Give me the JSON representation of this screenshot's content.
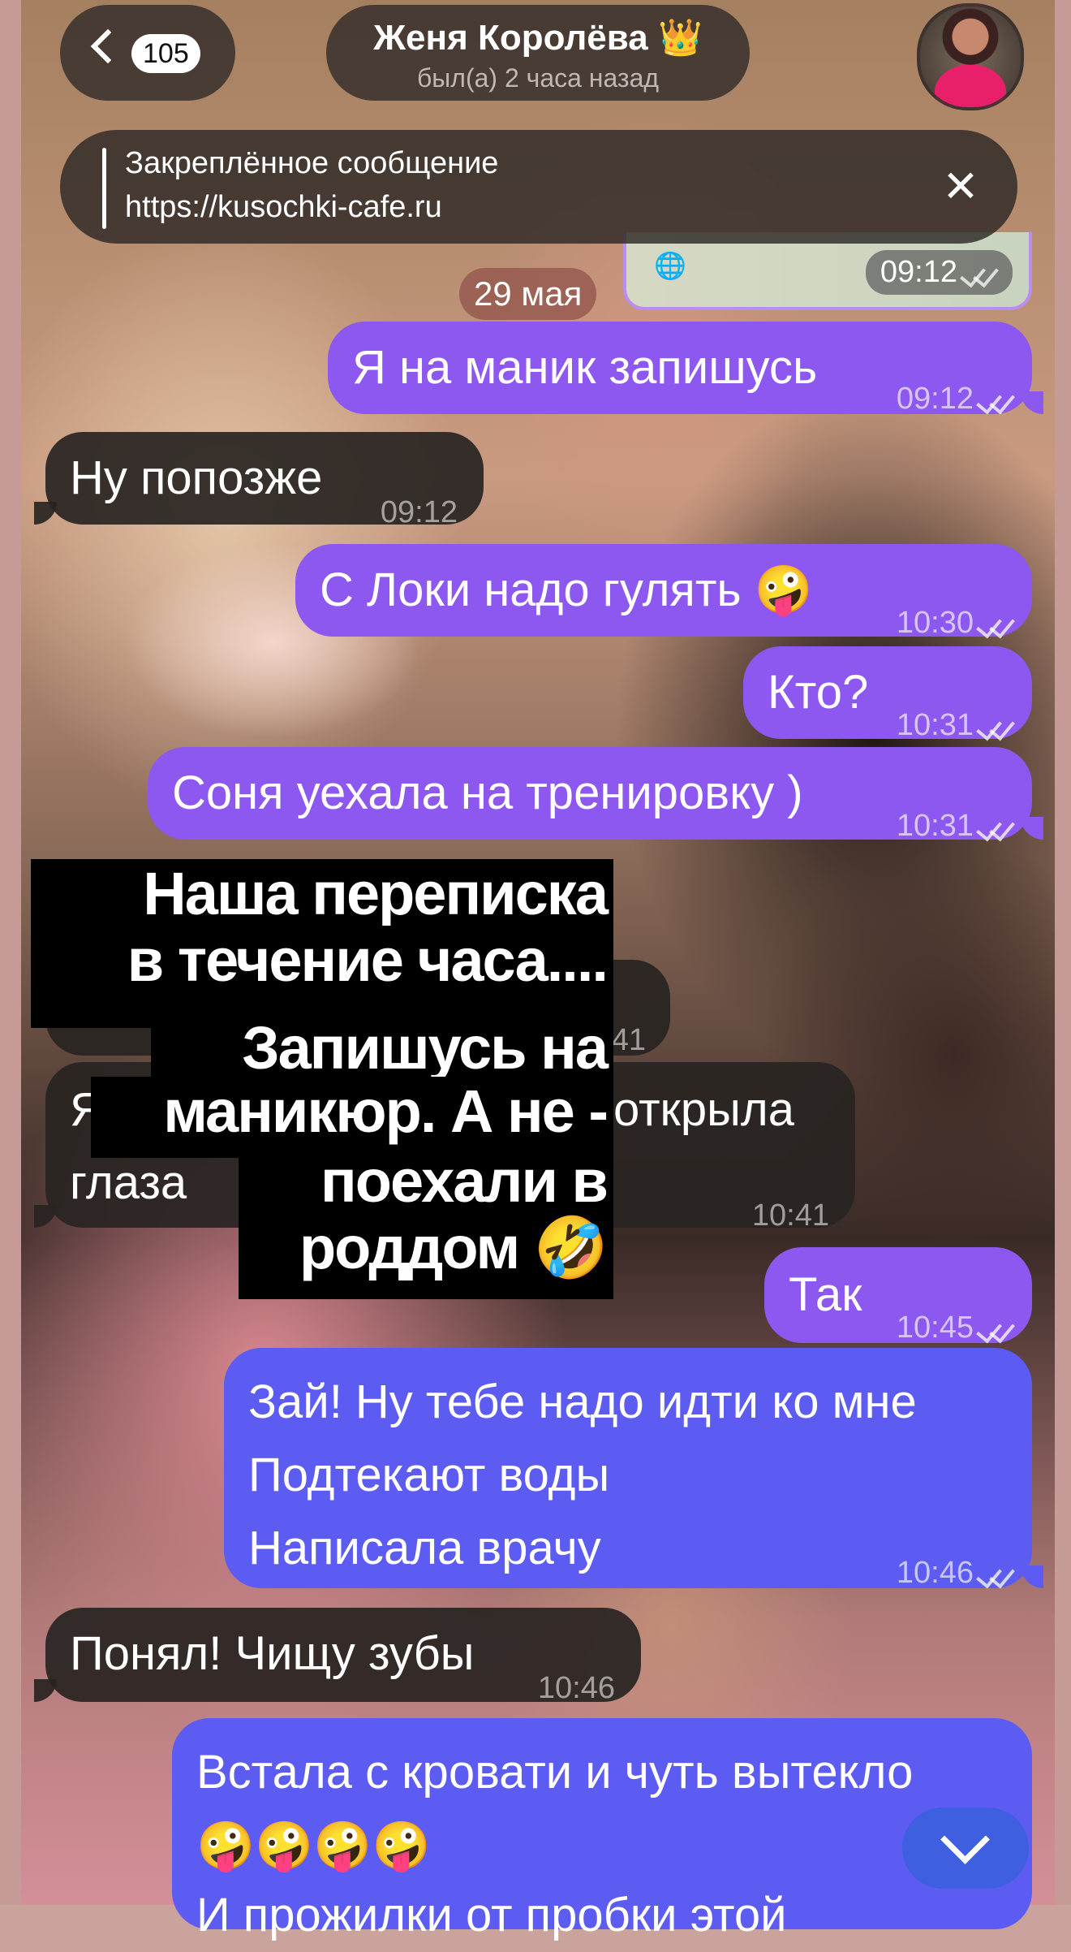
{
  "header": {
    "back_count": "105",
    "contact_name": "Женя Королёва",
    "name_emoji": "👑",
    "status": "был(а) 2 часа назад"
  },
  "pinned": {
    "title": "Закреплённое сообщение",
    "text": "https://kusochki-cafe.ru",
    "close_glyph": "✕"
  },
  "preview": {
    "globe": "🌐",
    "time": "09:12"
  },
  "date_chip": "29 мая",
  "messages": [
    {
      "dir": "out",
      "text": "Я на маник запишусь",
      "time": "09:12"
    },
    {
      "dir": "in",
      "text": "Ну попозже",
      "time": "09:12"
    },
    {
      "dir": "out",
      "text": "С Локи надо гулять 🤪",
      "time": "10:30"
    },
    {
      "dir": "out",
      "text": "Кто?",
      "time": "10:31"
    },
    {
      "dir": "out",
      "text": "Соня уехала на тренировку )",
      "time": "10:31"
    },
    {
      "dir": "in",
      "text": "41",
      "time": ""
    },
    {
      "dir": "in",
      "lines": [
        "Я",
        "глаза"
      ],
      "text_right": "открыла",
      "time": "10:41"
    },
    {
      "dir": "out",
      "text": "Так",
      "time": "10:45"
    },
    {
      "dir": "out",
      "lines": [
        "Зай! Ну тебе надо идти ко мне",
        "Подтекают воды",
        "Написала врачу"
      ],
      "time": "10:46"
    },
    {
      "dir": "in",
      "text": "Понял! Чищу зубы",
      "time": "10:46"
    },
    {
      "dir": "out",
      "lines": [
        "Встала с кровати и чуть вытекло",
        "🤪🤪🤪🤪",
        "И прожилки от пробки этой"
      ],
      "time": ""
    }
  ],
  "caption": {
    "lines": [
      "Наша переписка",
      "в течение часа....",
      "Запишусь на",
      "маникюр. А не -",
      "поехали в",
      "роддом 🤣"
    ]
  },
  "colors": {
    "outgoing": "#8d58ef",
    "outgoing_blue": "#5d5cf2",
    "incoming": "#282422",
    "pill": "#2d2826"
  },
  "icons": {
    "back": "chevron-left-icon",
    "close": "close-icon",
    "scroll": "chevron-down-icon",
    "read": "double-check-icon"
  }
}
